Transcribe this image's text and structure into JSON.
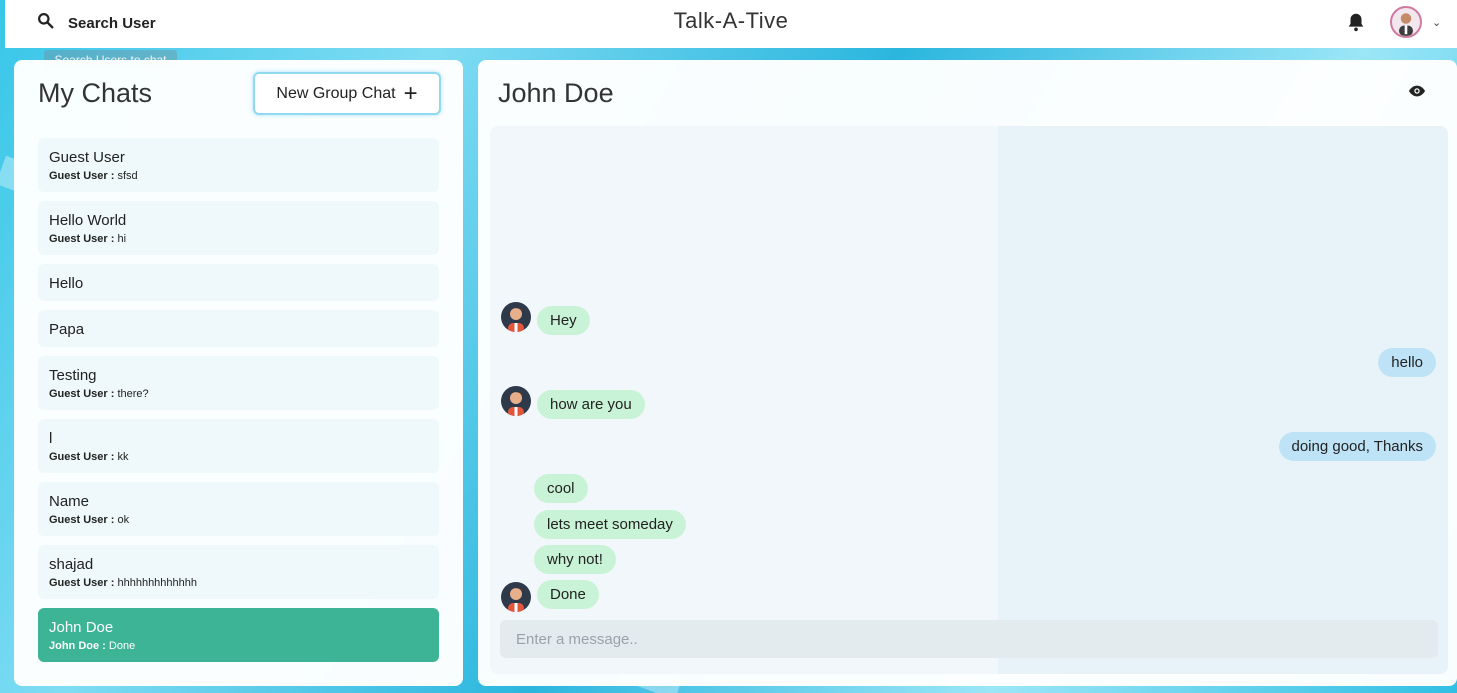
{
  "app": {
    "title": "Talk-A-Tive"
  },
  "topbar": {
    "search_label": "Search User",
    "search_tooltip": "Search Users to chat",
    "icons": [
      "search-icon",
      "bell-icon",
      "avatar",
      "chevron-down-icon"
    ]
  },
  "sidebar": {
    "title": "My Chats",
    "new_group_label": "New Group Chat",
    "chats": [
      {
        "name": "Guest User",
        "sender": "Guest User :",
        "preview": " sfsd"
      },
      {
        "name": "Hello World",
        "sender": "Guest User :",
        "preview": " hi"
      },
      {
        "name": "Hello",
        "sender": "",
        "preview": ""
      },
      {
        "name": "Papa",
        "sender": "",
        "preview": ""
      },
      {
        "name": "Testing",
        "sender": "Guest User :",
        "preview": " there?"
      },
      {
        "name": "l",
        "sender": "Guest User :",
        "preview": " kk"
      },
      {
        "name": "Name",
        "sender": "Guest User :",
        "preview": " ok"
      },
      {
        "name": "shajad",
        "sender": "Guest User :",
        "preview": " hhhhhhhhhhhhh"
      },
      {
        "name": "John Doe",
        "sender": "John Doe :",
        "preview": " Done",
        "active": true
      }
    ]
  },
  "chat": {
    "header": "John Doe",
    "messages": [
      {
        "text": "Hey",
        "mine": false
      },
      {
        "text": "hello",
        "mine": true
      },
      {
        "text": "how are you",
        "mine": false
      },
      {
        "text": "doing good, Thanks",
        "mine": true
      },
      {
        "text": "cool",
        "mine": false
      },
      {
        "text": "lets meet someday",
        "mine": false
      },
      {
        "text": "why not!",
        "mine": false
      },
      {
        "text": "Done",
        "mine": false
      }
    ],
    "input_placeholder": "Enter a message.."
  },
  "colors": {
    "accent_active": "#3cb495",
    "bubble_other": "#c9f3d6",
    "bubble_mine": "#bfe3f6",
    "background": "#38c6e8"
  }
}
